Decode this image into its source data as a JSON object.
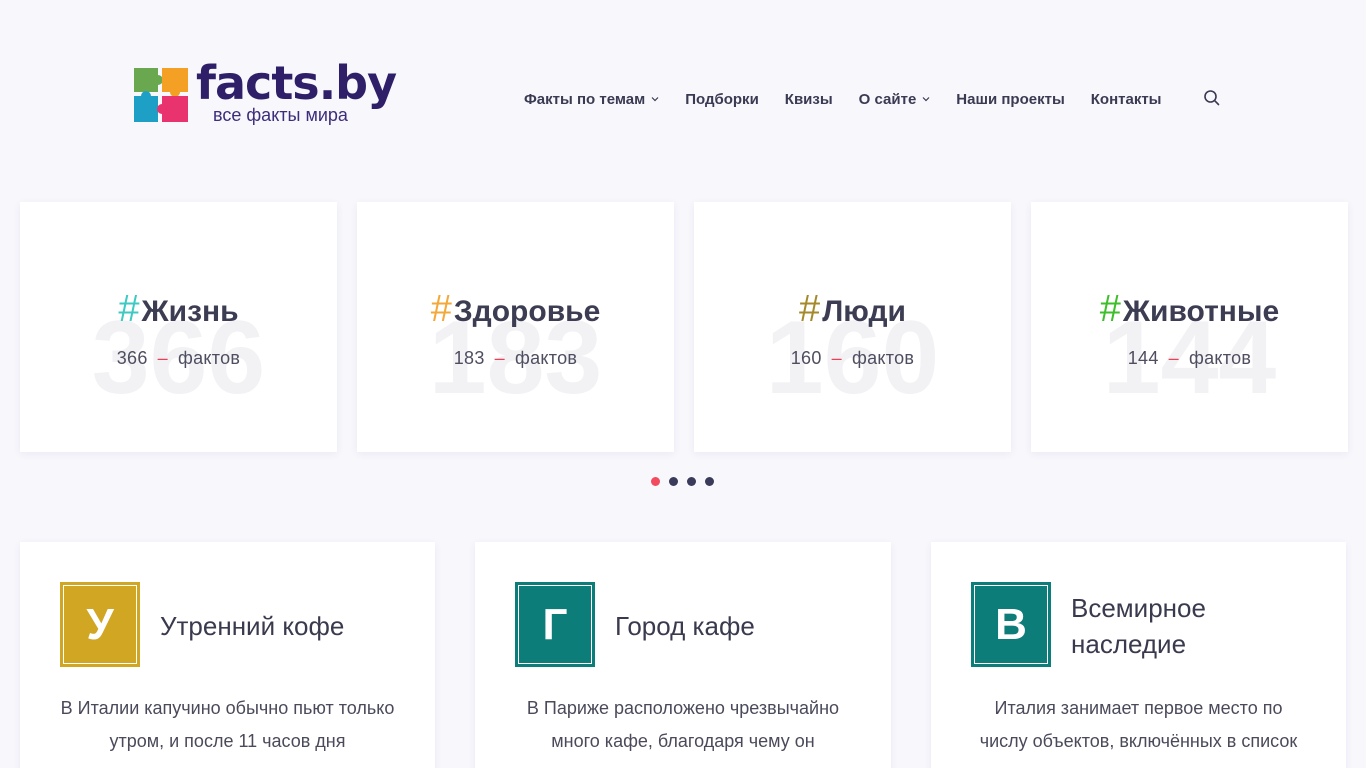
{
  "logo": {
    "name": "facts.by",
    "tagline": "все факты мира"
  },
  "nav": {
    "items": [
      {
        "label": "Факты по темам",
        "has_dropdown": true
      },
      {
        "label": "Подборки",
        "has_dropdown": false
      },
      {
        "label": "Квизы",
        "has_dropdown": false
      },
      {
        "label": "О сайте",
        "has_dropdown": true
      },
      {
        "label": "Наши проекты",
        "has_dropdown": false
      },
      {
        "label": "Контакты",
        "has_dropdown": false
      }
    ],
    "search_icon": "search-icon"
  },
  "categories": [
    {
      "hash": "#",
      "name": "Жизнь",
      "count": "366",
      "dash": "–",
      "unit": "фактов",
      "hash_color": "#3ec9c3"
    },
    {
      "hash": "#",
      "name": "Здоровье",
      "count": "183",
      "dash": "–",
      "unit": "фактов",
      "hash_color": "#f4a83a"
    },
    {
      "hash": "#",
      "name": "Люди",
      "count": "160",
      "dash": "–",
      "unit": "фактов",
      "hash_color": "#a48a2a"
    },
    {
      "hash": "#",
      "name": "Животные",
      "count": "144",
      "dash": "–",
      "unit": "фактов",
      "hash_color": "#3cbf2a"
    }
  ],
  "slider": {
    "dot_count": 4,
    "active_index": 0,
    "active_color": "#f24a5e"
  },
  "facts": [
    {
      "letter": "У",
      "title": "Утренний кофе",
      "badge_color": "#d0a623",
      "text": "В Италии капучино обычно пьют только утром, и после 11 часов дня"
    },
    {
      "letter": "Г",
      "title": "Город кафе",
      "badge_color": "#0d7d79",
      "text": "В Париже расположено чрезвычайно много кафе, благодаря чему он"
    },
    {
      "letter": "В",
      "title": "Всемирное наследие",
      "badge_color": "#0d7d79",
      "text": "Италия занимает первое место по числу объектов, включённых в список"
    }
  ]
}
